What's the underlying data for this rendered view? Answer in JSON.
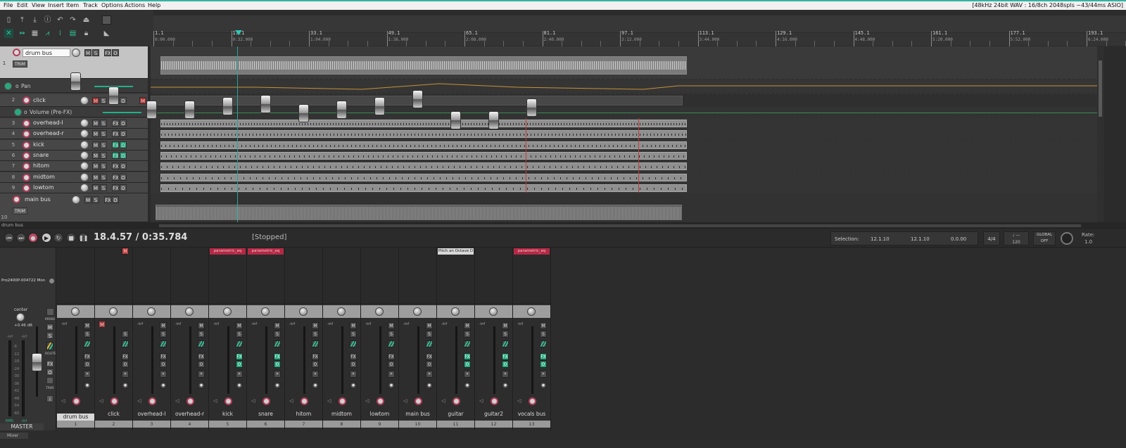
{
  "menu": [
    "File",
    "Edit",
    "View",
    "Insert",
    "Item",
    "Track",
    "Options",
    "Actions",
    "Help"
  ],
  "audio_info": "[48kHz 24bit WAV : 16/8ch 2048spls ~43/44ms ASIO]",
  "ruler": [
    {
      "bar": "1.1",
      "time": "0:00.000"
    },
    {
      "bar": "17.1",
      "time": "0:32.000"
    },
    {
      "bar": "33.1",
      "time": "1:04.000"
    },
    {
      "bar": "49.1",
      "time": "1:36.000"
    },
    {
      "bar": "65.1",
      "time": "2:08.000"
    },
    {
      "bar": "81.1",
      "time": "2:40.000"
    },
    {
      "bar": "97.1",
      "time": "3:12.000"
    },
    {
      "bar": "113.1",
      "time": "3:44.000"
    },
    {
      "bar": "129.1",
      "time": "4:16.000"
    },
    {
      "bar": "145.1",
      "time": "4:48.000"
    },
    {
      "bar": "161.1",
      "time": "5:20.000"
    },
    {
      "bar": "177.1",
      "time": "5:52.000"
    },
    {
      "bar": "193.1",
      "time": "6:24.000"
    }
  ],
  "tracks": [
    {
      "num": "1",
      "name": "drum bus",
      "selected": true
    },
    {
      "num": "2",
      "name": "click"
    },
    {
      "num": "3",
      "name": "overhead-l"
    },
    {
      "num": "4",
      "name": "overhead-r"
    },
    {
      "num": "5",
      "name": "kick"
    },
    {
      "num": "6",
      "name": "snare"
    },
    {
      "num": "7",
      "name": "hitom"
    },
    {
      "num": "8",
      "name": "midtom"
    },
    {
      "num": "9",
      "name": "lowtom"
    },
    {
      "num": "10",
      "name": "main bus"
    }
  ],
  "envelopes": {
    "pan": "Pan",
    "volume": "Volume (Pre-FX)"
  },
  "trim_label": "TRIM",
  "buttons": {
    "mute": "M",
    "solo": "S",
    "fx": "FX",
    "io": "O"
  },
  "status_track": "drum bus",
  "transport": {
    "position": "18.4.57 / 0:35.784",
    "state": "[Stopped]",
    "selection_label": "Selection:",
    "sel_start": "12.1.10",
    "sel_end": "12.1.10",
    "sel_len": "0.0.00",
    "time_sig": "4/4",
    "bpm": "120",
    "global_label": "GLOBAL",
    "global_state": "OFF",
    "rate_label": "Rate:",
    "rate_value": "1.0"
  },
  "master": {
    "device": "Pro2400P-004722 Mon",
    "pan": "center",
    "volume": "+0.46 dB",
    "inf_l": "-inf",
    "inf_r": "-inf",
    "label": "MASTER",
    "rms": "RMS",
    "rms_val": "-inf",
    "mono": "MONO",
    "route": "ROUTE",
    "trim": "TRIM",
    "scale": [
      "-6",
      "-12",
      "-18",
      "-24",
      "-30",
      "-36",
      "-42",
      "-48",
      "-54",
      "-60"
    ]
  },
  "mixer_tab": "Mixer",
  "strips": [
    {
      "name": "drum bus",
      "num": "1",
      "fx": "",
      "selected": true
    },
    {
      "name": "click",
      "num": "2",
      "fx": ""
    },
    {
      "name": "overhead-l",
      "num": "3",
      "fx": ""
    },
    {
      "name": "overhead-r",
      "num": "4",
      "fx": ""
    },
    {
      "name": "kick",
      "num": "5",
      "fx": "parametric_eq"
    },
    {
      "name": "snare",
      "num": "6",
      "fx": "parametric_eq"
    },
    {
      "name": "hitom",
      "num": "7",
      "fx": ""
    },
    {
      "name": "midtom",
      "num": "8",
      "fx": ""
    },
    {
      "name": "lowtom",
      "num": "9",
      "fx": ""
    },
    {
      "name": "main bus",
      "num": "10",
      "fx": ""
    },
    {
      "name": "guitar",
      "num": "11",
      "fx": "Pitch an Octave D"
    },
    {
      "name": "guitar2",
      "num": "12",
      "fx": ""
    },
    {
      "name": "vocals bus",
      "num": "13",
      "fx": "parametric_eq"
    }
  ],
  "inf": "-inf",
  "colors": {
    "accent": "#2fc79a",
    "record": "#b23c5a",
    "fx_bg": "#b42945"
  }
}
